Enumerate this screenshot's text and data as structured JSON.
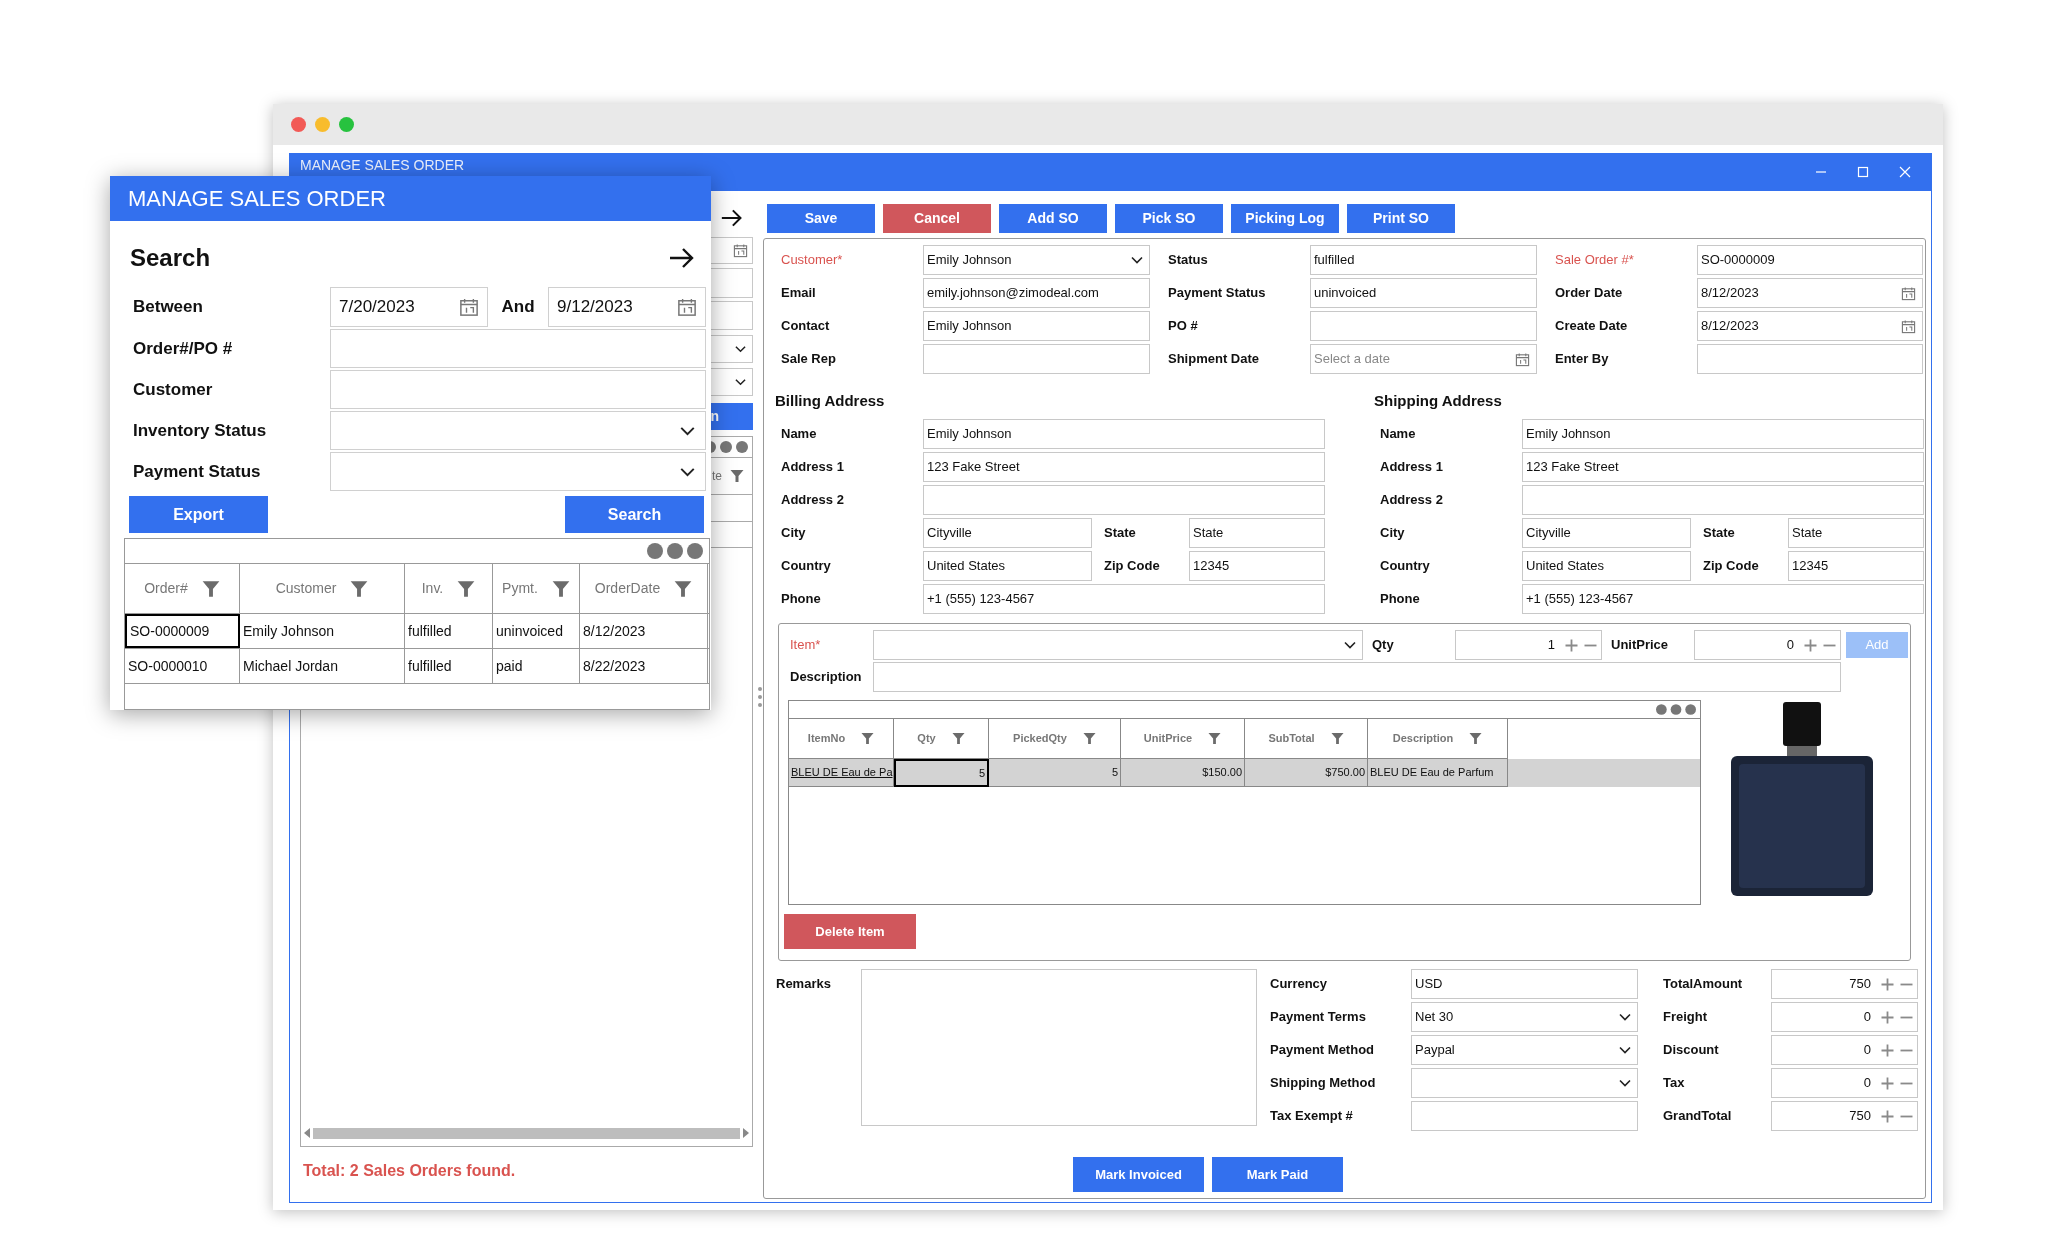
{
  "desktop_window": {
    "title": "MANAGE SALES ORDER"
  },
  "list_pane": {
    "button_fragment": "n",
    "column_fragment": "te",
    "status": "Total: 2 Sales Orders found."
  },
  "search_popup": {
    "title": "MANAGE SALES ORDER",
    "heading": "Search",
    "between": {
      "label": "Between",
      "from": "7/20/2023",
      "and": "And",
      "to": "9/12/2023"
    },
    "filters": [
      {
        "label": "Order#/PO #",
        "kind": "text"
      },
      {
        "label": "Customer",
        "kind": "text"
      },
      {
        "label": "Inventory Status",
        "kind": "select"
      },
      {
        "label": "Payment Status",
        "kind": "select"
      }
    ],
    "buttons": [
      "Export",
      "Search"
    ],
    "grid": {
      "columns": [
        "Order#",
        "Customer",
        "Inv.",
        "Pymt.",
        "OrderDate"
      ],
      "rows": [
        {
          "cells": [
            "SO-0000009",
            "Emily Johnson",
            "fulfilled",
            "uninvoiced",
            "8/12/2023"
          ],
          "selected": true
        },
        {
          "cells": [
            "SO-0000010",
            "Michael Jordan",
            "fulfilled",
            "paid",
            "8/22/2023"
          ],
          "selected": false
        }
      ]
    }
  },
  "toolbar": [
    {
      "label": "Save",
      "kind": "primary"
    },
    {
      "label": "Cancel",
      "kind": "danger"
    },
    {
      "label": "Add SO",
      "kind": "primary"
    },
    {
      "label": "Pick SO",
      "kind": "primary"
    },
    {
      "label": "Picking Log",
      "kind": "primary"
    },
    {
      "label": "Print SO",
      "kind": "primary"
    }
  ],
  "header_columns": [
    [
      {
        "label": "Customer*",
        "kind": "select",
        "value": "Emily Johnson",
        "required": true
      },
      {
        "label": "Email",
        "kind": "text",
        "value": "emily.johnson@zimodeal.com",
        "required": false
      },
      {
        "label": "Contact",
        "kind": "text",
        "value": "Emily Johnson",
        "required": false
      },
      {
        "label": "Sale Rep",
        "kind": "text",
        "required": false
      }
    ],
    [
      {
        "label": "Status",
        "kind": "text",
        "value": "fulfilled",
        "required": false
      },
      {
        "label": "Payment Status",
        "kind": "text",
        "value": "uninvoiced",
        "required": false
      },
      {
        "label": "PO #",
        "kind": "text",
        "required": false
      },
      {
        "label": "Shipment Date",
        "kind": "date",
        "placeholder": "Select a date",
        "required": false
      }
    ],
    [
      {
        "label": "Sale Order #*",
        "kind": "text",
        "value": "SO-0000009",
        "required": true
      },
      {
        "label": "Order Date",
        "kind": "date",
        "value": "8/12/2023",
        "required": false
      },
      {
        "label": "Create Date",
        "kind": "date",
        "value": "8/12/2023",
        "required": false
      },
      {
        "label": "Enter By",
        "kind": "text",
        "required": false
      }
    ]
  ],
  "addresses": [
    {
      "title": "Billing Address",
      "rows": [
        [
          {
            "label": "Name",
            "value": "Emily Johnson"
          }
        ],
        [
          {
            "label": "Address 1",
            "value": "123 Fake Street"
          }
        ],
        [
          {
            "label": "Address 2"
          }
        ],
        [
          {
            "label": "City",
            "value": "Cityville"
          },
          {
            "label": "State",
            "value": "State"
          }
        ],
        [
          {
            "label": "Country",
            "value": "United States"
          },
          {
            "label": "Zip Code",
            "value": "12345"
          }
        ],
        [
          {
            "label": "Phone",
            "value": "+1 (555) 123-4567"
          }
        ]
      ]
    },
    {
      "title": "Shipping Address",
      "rows": [
        [
          {
            "label": "Name",
            "value": "Emily Johnson"
          }
        ],
        [
          {
            "label": "Address 1",
            "value": "123 Fake Street"
          }
        ],
        [
          {
            "label": "Address 2"
          }
        ],
        [
          {
            "label": "City",
            "value": "Cityville"
          },
          {
            "label": "State",
            "value": "State"
          }
        ],
        [
          {
            "label": "Country",
            "value": "United States"
          },
          {
            "label": "Zip Code",
            "value": "12345"
          }
        ],
        [
          {
            "label": "Phone",
            "value": "+1 (555) 123-4567"
          }
        ]
      ]
    }
  ],
  "item_entry": {
    "item": {
      "label": "Item*",
      "required": true
    },
    "qty": {
      "label": "Qty",
      "value": "1"
    },
    "unit_price": {
      "label": "UnitPrice",
      "value": "0"
    },
    "add_button": {
      "label": "Add",
      "disabled": true
    },
    "description": {
      "label": "Description"
    }
  },
  "item_grid": {
    "columns": [
      "ItemNo",
      "Qty",
      "PickedQty",
      "UnitPrice",
      "SubTotal",
      "Description"
    ],
    "rows": [
      {
        "cells": [
          "BLEU DE Eau de Pa",
          "5",
          "5",
          "$150.00",
          "$750.00",
          "BLEU DE Eau de Parfum"
        ],
        "selected": true
      }
    ]
  },
  "delete_button": "Delete Item",
  "remarks_label": "Remarks",
  "payment_fields": [
    {
      "label": "Currency",
      "kind": "text",
      "value": "USD"
    },
    {
      "label": "Payment Terms",
      "kind": "select",
      "value": "Net 30"
    },
    {
      "label": "Payment Method",
      "kind": "select",
      "value": "Paypal"
    },
    {
      "label": "Shipping Method",
      "kind": "select"
    },
    {
      "label": "Tax Exempt #",
      "kind": "text"
    }
  ],
  "totals": [
    {
      "label": "TotalAmount",
      "value": "750"
    },
    {
      "label": "Freight",
      "value": "0"
    },
    {
      "label": "Discount",
      "value": "0"
    },
    {
      "label": "Tax",
      "value": "0"
    },
    {
      "label": "GrandTotal",
      "value": "750"
    }
  ],
  "action_buttons": [
    "Mark Invoiced",
    "Mark Paid"
  ]
}
